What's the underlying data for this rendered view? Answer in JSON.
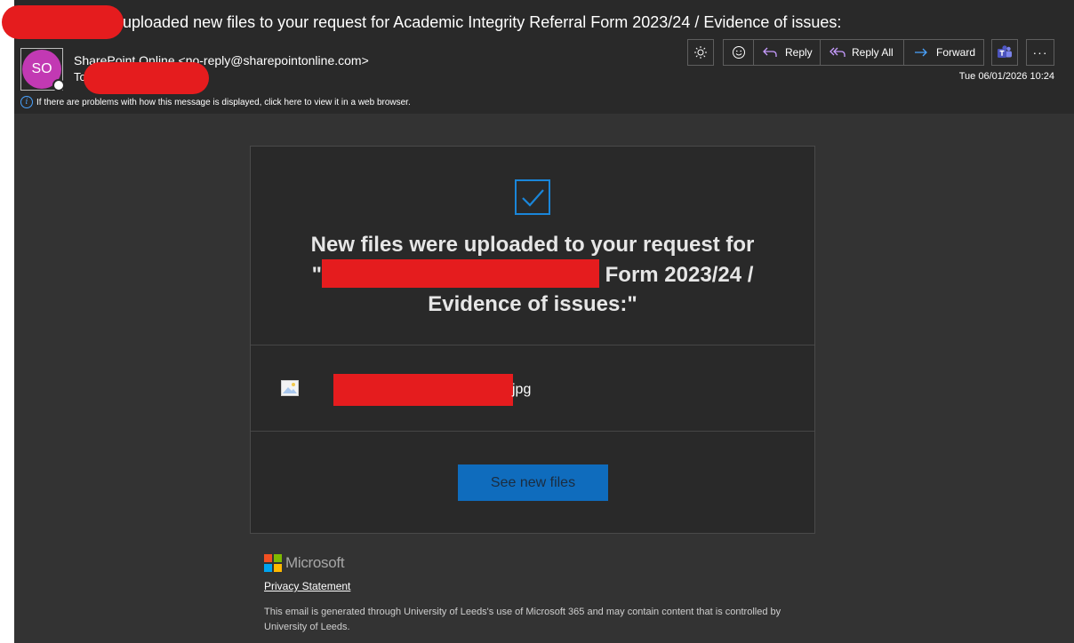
{
  "email": {
    "subject": "uploaded new files to your request for Academic Integrity Referral Form 2023/24 / Evidence of issues:",
    "avatar_initials": "SO",
    "sender": "SharePoint Online <no-reply@sharepointonline.com>",
    "to_label": "To",
    "date": "Tue 06/01/2026 10:24",
    "info_text": "If there are problems with how this message is displayed, click here to view it in a web browser."
  },
  "toolbar": {
    "reply_label": "Reply",
    "reply_all_label": "Reply All",
    "forward_label": "Forward",
    "more_label": "···"
  },
  "body": {
    "headline_line1": "New files were uploaded to your request for",
    "headline_quote_open": "\"",
    "headline_line2_end": " Form 2023/24 /",
    "headline_line3": "Evidence of issues:\"",
    "file_suffix": "jpg",
    "cta_label": "See new files",
    "ms_name": "Microsoft",
    "privacy_label": "Privacy Statement",
    "disclaimer": "This email is generated through University of Leeds's use of Microsoft 365 and may contain content that is controlled by University of Leeds."
  },
  "colors": {
    "accent": "#0f6cbd",
    "avatar": "#c239b3",
    "redaction": "#e51c1e"
  }
}
